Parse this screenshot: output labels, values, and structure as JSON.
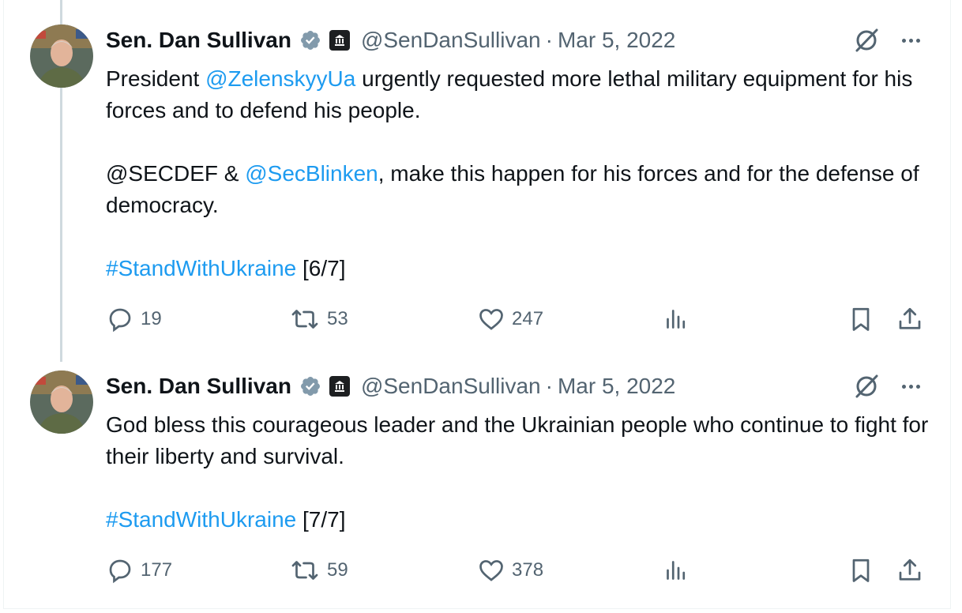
{
  "tweets": [
    {
      "author": {
        "name": "Sen. Dan Sullivan",
        "handle": "@SenDanSullivan",
        "date": "Mar 5, 2022"
      },
      "text": {
        "line1_prefix": "President ",
        "line1_mention": "@ZelenskyyUa",
        "line1_suffix": " urgently requested more lethal military equipment for his forces and to defend his people.",
        "line2_prefix": "@SECDEF & ",
        "line2_mention": "@SecBlinken",
        "line2_suffix": ", make this happen for his forces and for the defense of democracy.",
        "hashtag": "#StandWithUkraine",
        "counter": " [6/7]"
      },
      "stats": {
        "replies": "19",
        "reposts": "53",
        "likes": "247"
      }
    },
    {
      "author": {
        "name": "Sen. Dan Sullivan",
        "handle": "@SenDanSullivan",
        "date": "Mar 5, 2022"
      },
      "text": {
        "line1": "God bless this courageous leader and the Ukrainian people who continue to fight for their liberty and survival.",
        "hashtag": "#StandWithUkraine",
        "counter": " [7/7]"
      },
      "stats": {
        "replies": "177",
        "reposts": "59",
        "likes": "378"
      }
    }
  ],
  "separator": "·",
  "icons": {
    "verified": "verified-badge-icon",
    "affiliation": "government-building-icon",
    "grok": "grok-icon",
    "more": "more-dots-icon",
    "reply": "reply-icon",
    "repost": "repost-icon",
    "like": "heart-icon",
    "views": "analytics-icon",
    "bookmark": "bookmark-icon",
    "share": "share-icon"
  },
  "colors": {
    "text": "#0f1419",
    "secondary": "#536471",
    "link": "#1d9bf0",
    "thread_line": "#cfd9de",
    "verified_badge": "#829aab"
  }
}
